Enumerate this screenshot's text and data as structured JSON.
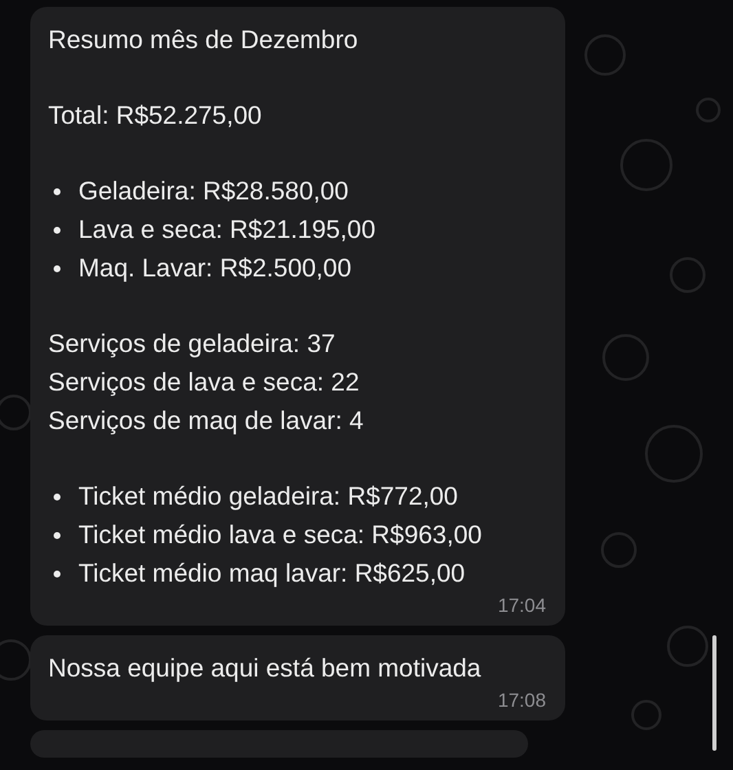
{
  "messages": [
    {
      "blocks": [
        {
          "kind": "text",
          "lines": [
            "Resumo mês de Dezembro"
          ]
        },
        {
          "kind": "text",
          "lines": [
            "Total: R$52.275,00"
          ]
        },
        {
          "kind": "bullets",
          "lines": [
            "Geladeira: R$28.580,00",
            "Lava e seca: R$21.195,00",
            "Maq. Lavar: R$2.500,00"
          ]
        },
        {
          "kind": "text",
          "lines": [
            "Serviços de geladeira: 37",
            "Serviços de lava e seca: 22",
            "Serviços de maq de lavar: 4"
          ]
        },
        {
          "kind": "bullets",
          "lines": [
            "Ticket médio geladeira: R$772,00",
            "Ticket médio lava e seca: R$963,00",
            "Ticket médio maq lavar: R$625,00"
          ]
        }
      ],
      "time": "17:04"
    },
    {
      "blocks": [
        {
          "kind": "text",
          "lines": [
            "Nossa equipe aqui está bem motivada"
          ]
        }
      ],
      "time": "17:08"
    }
  ]
}
